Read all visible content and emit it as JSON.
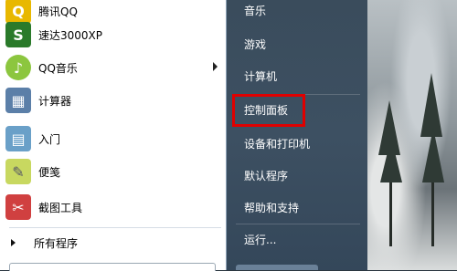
{
  "programs": [
    {
      "label": "腾讯QQ",
      "icon": "qq-penguin-icon",
      "color": "#e8b800",
      "glyph": "Q",
      "has_submenu": false
    },
    {
      "label": "速达3000XP",
      "icon": "sudaxp-icon",
      "color": "#2a7a2a",
      "glyph": "S",
      "has_submenu": false
    },
    {
      "label": "QQ音乐",
      "icon": "qq-music-icon",
      "color": "#8cc63f",
      "glyph": "♪",
      "has_submenu": true
    },
    {
      "label": "计算器",
      "icon": "calculator-icon",
      "color": "#5b7fa8",
      "glyph": "▦",
      "has_submenu": false
    },
    {
      "label": "入门",
      "icon": "getting-started-icon",
      "color": "#6aa0c8",
      "glyph": "▤",
      "has_submenu": false
    },
    {
      "label": "便笺",
      "icon": "sticky-notes-icon",
      "color": "#c8d860",
      "glyph": "✎",
      "has_submenu": false
    },
    {
      "label": "截图工具",
      "icon": "snipping-tool-icon",
      "color": "#d04040",
      "glyph": "✂",
      "has_submenu": false
    }
  ],
  "all_programs_label": "所有程序",
  "right_items": [
    {
      "label": "音乐"
    },
    {
      "label": "游戏"
    },
    {
      "label": "计算机"
    },
    {
      "label": "控制面板"
    },
    {
      "label": "设备和打印机"
    },
    {
      "label": "默认程序"
    },
    {
      "label": "帮助和支持"
    },
    {
      "label": "运行..."
    }
  ],
  "highlight_color": "#e00000"
}
